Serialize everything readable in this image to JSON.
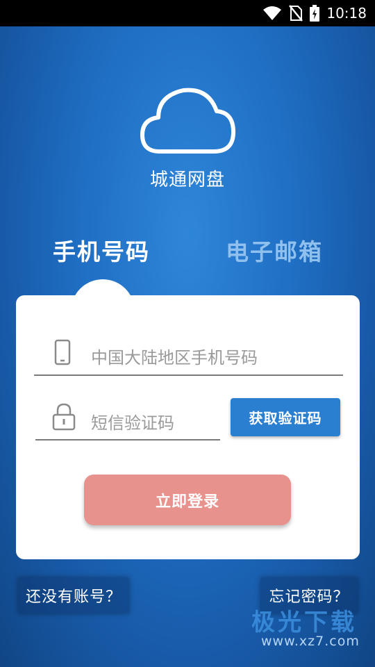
{
  "status_bar": {
    "time": "10:18",
    "icons": [
      "wifi-icon",
      "no-sim-icon",
      "battery-charging-icon"
    ]
  },
  "app": {
    "title": "城通网盘",
    "logo_icon": "cloud-icon"
  },
  "tabs": [
    {
      "label": "手机号码",
      "active": true
    },
    {
      "label": "电子邮箱",
      "active": false
    }
  ],
  "login_form": {
    "phone_placeholder": "中国大陆地区手机号码",
    "phone_icon": "phone-icon",
    "code_placeholder": "短信验证码",
    "code_icon": "lock-icon",
    "get_code_label": "获取验证码",
    "login_label": "立即登录"
  },
  "footer": {
    "register_link": "还没有账号？",
    "forgot_link": "忘记密码？"
  },
  "watermark": {
    "name": "极光下载",
    "url": "www.xz7.com"
  },
  "colors": {
    "background": "#1f6fc4",
    "primary_button": "#2b7fd1",
    "login_button": "#e8928e",
    "inactive_tab": "#8fc0ee"
  }
}
